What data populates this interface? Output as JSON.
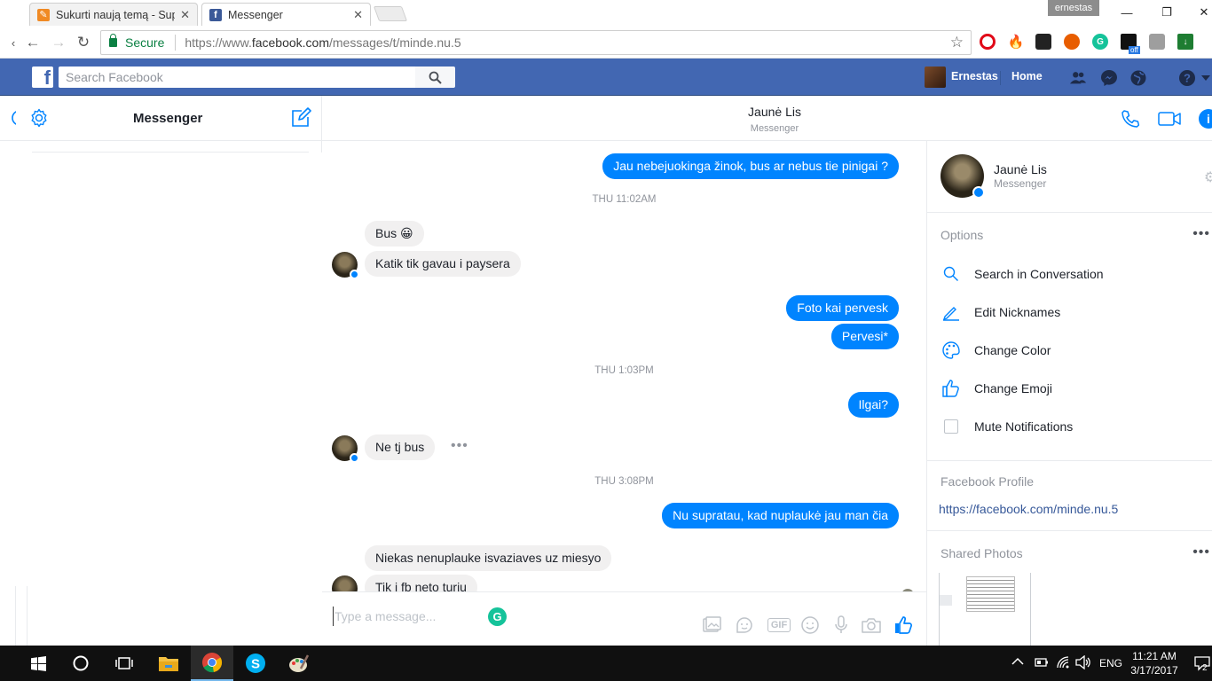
{
  "browser": {
    "tabs": [
      {
        "title": "Sukurti naują temą - Sup",
        "active": false
      },
      {
        "title": "Messenger",
        "active": true
      }
    ],
    "profile_badge": "ernestas",
    "secure_label": "Secure",
    "url_prefix": "https://www.",
    "url_host": "facebook.com",
    "url_path": "/messages/t/minde.nu.5",
    "extension_badge": "off"
  },
  "facebook": {
    "search_placeholder": "Search Facebook",
    "user_name": "Ernestas",
    "home_label": "Home",
    "logo_letter": "f"
  },
  "messenger": {
    "sidebar_title": "Messenger",
    "conversation_name": "Jaunė Lis",
    "conversation_subtitle": "Messenger",
    "composer_placeholder": "Type a message...",
    "gif_label": "GIF",
    "grammarly_letter": "G"
  },
  "thread": {
    "m1": "Jau nebejuokinga žinok, bus ar nebus tie pinigai ?",
    "ts1": "THU 11:02AM",
    "m2": "Bus 😀",
    "m3": "Katik tik gavau i paysera",
    "m4": "Foto kai pervesk",
    "m5": "Pervesi*",
    "ts2": "THU 1:03PM",
    "m6": "Ilgai?",
    "m7": "Ne tj bus",
    "ts3": "THU 3:08PM",
    "m8": "Nu supratau, kad nuplaukė jau man čia",
    "m9": "Niekas nenuplauke isvaziaves uz miesyo",
    "m10": "Tik i fb neto turiu",
    "more_dots": "•••"
  },
  "info_panel": {
    "name": "Jaunė Lis",
    "subtitle": "Messenger",
    "options_heading": "Options",
    "options": [
      "Search in Conversation",
      "Edit Nicknames",
      "Change Color",
      "Change Emoji",
      "Mute Notifications"
    ],
    "profile_heading": "Facebook Profile",
    "profile_link": "https://facebook.com/minde.nu.5",
    "photos_heading": "Shared Photos",
    "menu_dots": "•••"
  },
  "taskbar": {
    "language": "ENG",
    "time": "11:21 AM",
    "date": "3/17/2017",
    "notification_count": "2"
  },
  "colors": {
    "facebook_blue": "#4267b2",
    "messenger_blue": "#0084ff",
    "incoming_bubble": "#f1f0f0",
    "secure_green": "#0b8043"
  }
}
